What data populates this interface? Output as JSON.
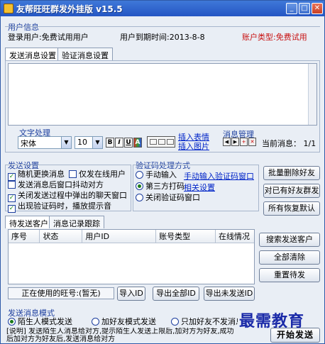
{
  "window": {
    "title": "友帮旺旺群发外挂版 v15.5"
  },
  "user_info": {
    "group_label": "用户信息",
    "login_user": "登录用户:免费试用用户",
    "expiry": "用户到期时间:2013-8-8",
    "account_type": "账户类型:免费试用"
  },
  "tabs_top": {
    "send_settings": "发送消息设置",
    "verify_settings": "验证消息设置"
  },
  "text_processing": {
    "group_label": "文字处理",
    "font": "宋体",
    "font_size": "10",
    "format_buttons": [
      "B",
      "I",
      "U",
      "A"
    ],
    "insert_emoji": "插入表情",
    "insert_image": "插入图片"
  },
  "message_manage": {
    "group_label": "消息管理",
    "current_message": "当前消息： 1/1"
  },
  "send_settings": {
    "group_label": "发送设置",
    "options": [
      {
        "label": "随机更换消息",
        "checked": true
      },
      {
        "label": "仅发在线用户",
        "checked": false
      },
      {
        "label": "发送消息后窗口抖动对方",
        "checked": false
      },
      {
        "label": "关闭发送过程中弹出的聊天窗口",
        "checked": true
      },
      {
        "label": "出现验证码时，播放提示音",
        "checked": true
      }
    ]
  },
  "captcha": {
    "group_label": "验证码处理方式",
    "manual": "手动输入",
    "manual_link": "手动输入验证码窗口",
    "third_party": "第三方打码",
    "third_party_link": "相关设置",
    "close_window": "关闭验证码窗口",
    "selected": "third_party"
  },
  "right_buttons": {
    "batch_delete": "批量删除好友",
    "to_existing": "对已有好友群发",
    "restore_default": "所有恢复默认"
  },
  "tabs_mid": {
    "pending": "待发送客户",
    "log": "消息记录跟踪"
  },
  "table": {
    "headers": [
      "序号",
      "状态",
      "用户ID",
      "账号类型",
      "在线情况"
    ]
  },
  "table_buttons": {
    "search": "搜索发送客户",
    "clear_all": "全部清除",
    "resend": "重置待发"
  },
  "bottom": {
    "current_wangwang": "正在使用的旺号:(暂无)",
    "import_id": "导入ID",
    "export_all": "导出全部ID",
    "export_unsent": "导出未发送ID"
  },
  "send_mode": {
    "group_label": "发送消息模式",
    "options": [
      "陌生人模式发送",
      "加好友模式发送",
      "只加好友不发消息"
    ],
    "selected": 0,
    "note": "[说明] 发送陌生人消息给对方,提示陌生人发送上限后,加对方为好友,成功后加对方为好友后,发送消息给对方"
  },
  "start_button": "开始发送",
  "watermark": "最需教育"
}
